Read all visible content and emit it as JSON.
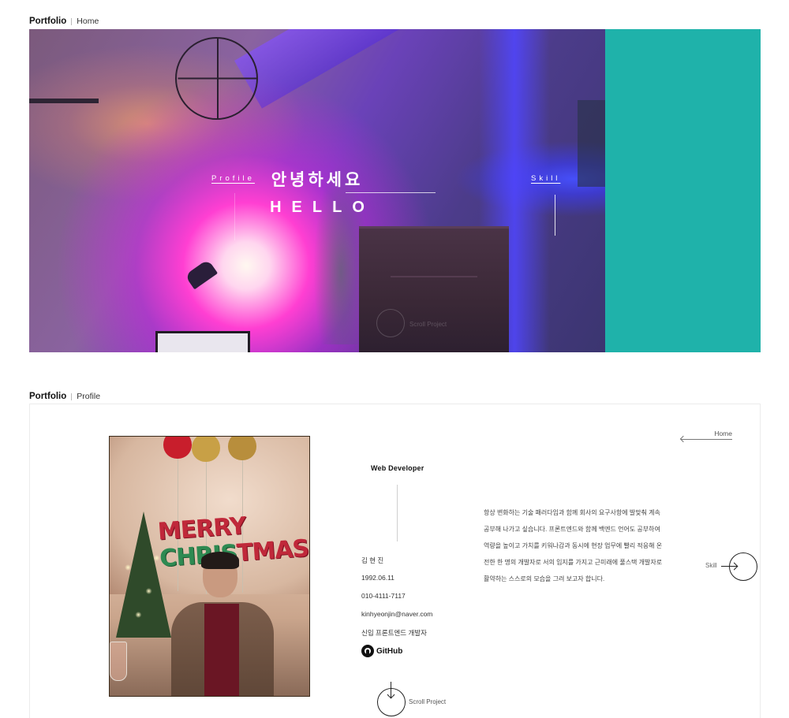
{
  "sections": {
    "hero": {
      "breadcrumb": {
        "brand": "Portfolio",
        "page": "Home"
      },
      "title_ko": "안녕하세요",
      "title_en": "HELLO",
      "link_left": "Profile",
      "link_right": "Skill",
      "scroll_label": "Scroll Project",
      "accent_color": "#1fb2aa"
    },
    "profile": {
      "breadcrumb": {
        "brand": "Portfolio",
        "page": "Profile"
      },
      "role": "Web Developer",
      "info": {
        "name": "김 현 진",
        "birth": "1992.06.11",
        "phone": "010-4111-7117",
        "email": "kinhyeonjin@naver.com",
        "position": "신입 프론트엔드 개발자"
      },
      "github_label": "GitHub",
      "intro_lines": [
        " 항상 변화하는 기술 패러다임과 함께 회사의 요구사항에 발맞춰 계속",
        "공부해 나가고 싶습니다. 프론트엔드와 함께 백엔드 언어도 공부하여",
        "역량을 높이고 가치를 키워나감과 동시에 현장 업무에 빨리 적응해 온",
        "전한 한 명의 개발자로 서의 입지를 가지고 근미래에 풀스택 개발자로",
        "활약하는 스스로의 모습을 그려 보고자 합니다."
      ],
      "nav_home": "Home",
      "nav_skill": "Skill",
      "scroll_label": "Scroll Project",
      "photo_text": {
        "line1": "MERRY",
        "line2_a": "CHRIS",
        "line2_b": "TMAS"
      }
    }
  },
  "icons": [
    "github-icon",
    "arrow-left-icon",
    "arrow-right-icon",
    "arrow-down-icon"
  ]
}
